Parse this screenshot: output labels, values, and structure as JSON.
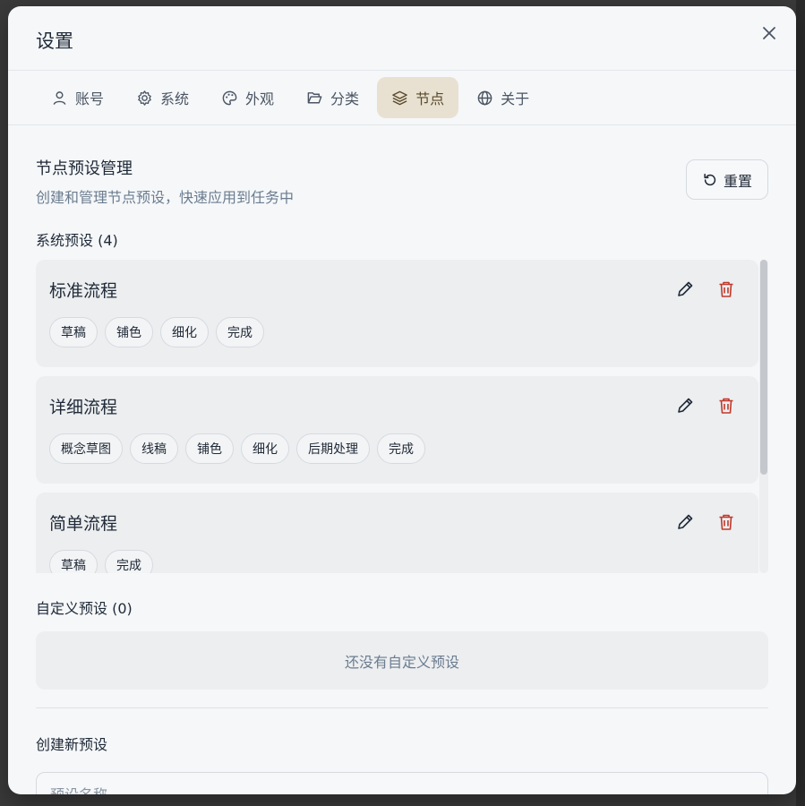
{
  "dialog": {
    "title": "设置"
  },
  "tabs": [
    {
      "label": "账号",
      "icon": "user-icon",
      "active": false
    },
    {
      "label": "系统",
      "icon": "gear-icon",
      "active": false
    },
    {
      "label": "外观",
      "icon": "palette-icon",
      "active": false
    },
    {
      "label": "分类",
      "icon": "folder-icon",
      "active": false
    },
    {
      "label": "节点",
      "icon": "layers-icon",
      "active": true
    },
    {
      "label": "关于",
      "icon": "globe-icon",
      "active": false
    }
  ],
  "section": {
    "title": "节点预设管理",
    "description": "创建和管理节点预设，快速应用到任务中",
    "reset_label": "重置"
  },
  "system_presets": {
    "label": "系统预设 (4)",
    "items": [
      {
        "name": "标准流程",
        "steps": [
          "草稿",
          "铺色",
          "细化",
          "完成"
        ]
      },
      {
        "name": "详细流程",
        "steps": [
          "概念草图",
          "线稿",
          "铺色",
          "细化",
          "后期处理",
          "完成"
        ]
      },
      {
        "name": "简单流程",
        "steps": [
          "草稿",
          "完成"
        ]
      }
    ]
  },
  "custom_presets": {
    "label": "自定义预设 (0)",
    "empty_text": "还没有自定义预设"
  },
  "create": {
    "label": "创建新预设",
    "name_placeholder": "预设名称"
  },
  "colors": {
    "accent_tab_bg": "#e8e1d2",
    "delete_red": "#c0392b"
  }
}
